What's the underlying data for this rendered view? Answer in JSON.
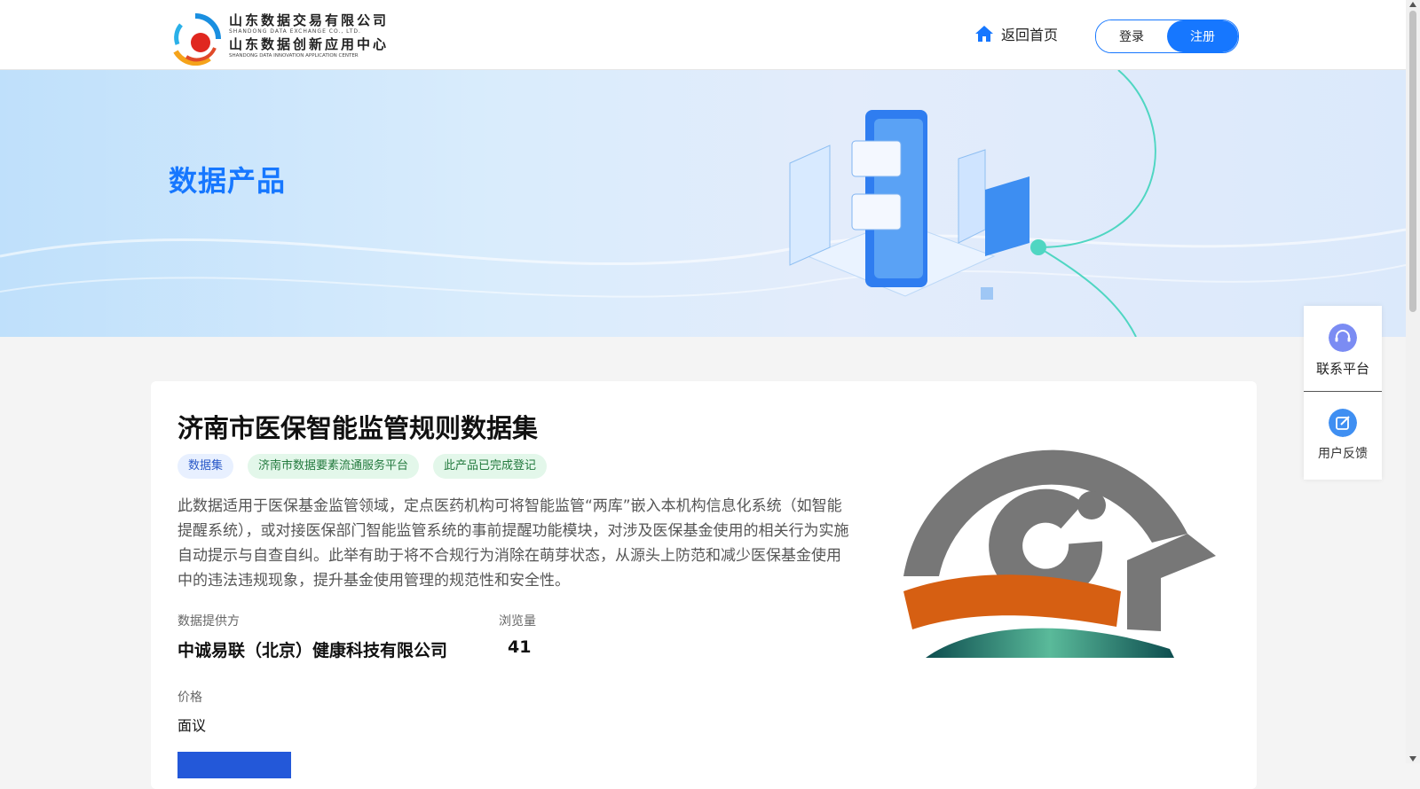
{
  "header": {
    "logo": {
      "line1": "山东数据交易有限公司",
      "line1_en": "SHANDONG DATA EXCHANGE CO., LTD.",
      "line2": "山东数据创新应用中心",
      "line2_en": "SHANDONG DATA INNOVATION APPLICATION CENTER"
    },
    "home_icon": "home-icon",
    "home_label": "返回首页",
    "login_label": "登录",
    "register_label": "注册"
  },
  "banner": {
    "title": "数据产品"
  },
  "product": {
    "title": "济南市医保智能监管规则数据集",
    "tags": [
      "数据集",
      "济南市数据要素流通服务平台",
      "此产品已完成登记"
    ],
    "description": "此数据适用于医保基金监管领域，定点医药机构可将智能监管“两库”嵌入本机构信息化系统（如智能提醒系统），或对接医保部门智能监管系统的事前提醒功能模块，对涉及医保基金使用的相关行为实施自动提示与自查自纠。此举有助于将不合规行为消除在萌芽状态，从源头上防范和减少医保基金使用中的违法违规现象，提升基金使用管理的规范性和安全性。",
    "provider_label": "数据提供方",
    "provider_value": "中诚易联（北京）健康科技有限公司",
    "views_label": "浏览量",
    "views_value": "41",
    "price_label": "价格",
    "price_value": "面议"
  },
  "side_panel": {
    "contact_label": "联系平台",
    "contact_icon": "headset-icon",
    "feedback_label": "用户反馈",
    "feedback_icon": "edit-icon"
  },
  "colors": {
    "primary": "#1677ff",
    "tag_blue_bg": "#e8f0ff",
    "tag_green_bg": "#e3f7ea",
    "cta": "#2358d9"
  }
}
